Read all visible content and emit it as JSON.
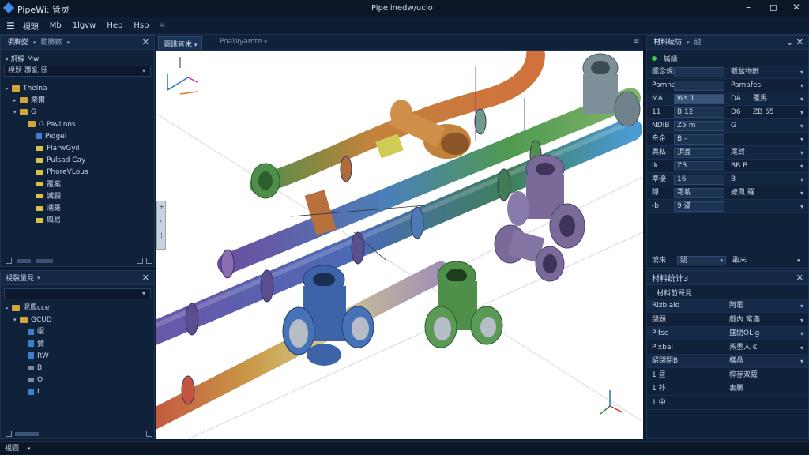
{
  "app": {
    "title": "PipeWi: 管灵",
    "window_title": "Pipelinedw/ucio"
  },
  "menu": [
    "視頭",
    "Mb",
    "1lgvw",
    "Hep",
    "Hsp"
  ],
  "left_top": {
    "tabs": [
      "項脚變",
      "勵勝數"
    ],
    "filter": "飛線 Mw",
    "select_label": "視題 覆亂  岡",
    "tree": [
      {
        "label": "Thelna",
        "icon": "folder",
        "indent": 0,
        "arrow": "▸"
      },
      {
        "label": "樂爾",
        "icon": "folder",
        "indent": 1,
        "arrow": "▸"
      },
      {
        "label": "G",
        "icon": "folder",
        "indent": 1,
        "arrow": "▾"
      },
      {
        "label": "G Pavlinos",
        "icon": "folder",
        "indent": 2,
        "arrow": ""
      },
      {
        "label": "Pidgel",
        "icon": "blue",
        "indent": 3,
        "arrow": ""
      },
      {
        "label": "FlarwGyil",
        "icon": "green",
        "indent": 3,
        "arrow": ""
      },
      {
        "label": "Pulsad Cay",
        "icon": "green",
        "indent": 3,
        "arrow": ""
      },
      {
        "label": "PhoreVLous",
        "icon": "green",
        "indent": 3,
        "arrow": ""
      },
      {
        "label": "覆案",
        "icon": "green",
        "indent": 3,
        "arrow": ""
      },
      {
        "label": "滅闢",
        "icon": "green",
        "indent": 3,
        "arrow": ""
      },
      {
        "label": "潮羅",
        "icon": "green",
        "indent": 3,
        "arrow": ""
      },
      {
        "label": "鳳易",
        "icon": "green",
        "indent": 3,
        "arrow": ""
      }
    ]
  },
  "left_bottom": {
    "tab": "視裂量見",
    "tree": [
      {
        "label": "泥鳳cce",
        "icon": "folder",
        "indent": 0,
        "arrow": "▸"
      },
      {
        "label": "GCUD",
        "icon": "folder",
        "indent": 1,
        "arrow": "▾"
      },
      {
        "label": "帽",
        "icon": "blue",
        "indent": 2,
        "arrow": ""
      },
      {
        "label": "贊",
        "icon": "blue",
        "indent": 2,
        "arrow": ""
      },
      {
        "label": "RW",
        "icon": "blue",
        "indent": 2,
        "arrow": ""
      },
      {
        "label": "B",
        "icon": "gray",
        "indent": 2,
        "arrow": ""
      },
      {
        "label": "O",
        "icon": "gray",
        "indent": 2,
        "arrow": ""
      },
      {
        "label": "I",
        "icon": "blue",
        "indent": 2,
        "arrow": ""
      }
    ]
  },
  "center": {
    "tabs": [
      "圓礁管末",
      "PoaWyamte"
    ]
  },
  "right_top": {
    "tabs": [
      "材料統坊",
      "越"
    ],
    "status_label": "属級",
    "rows": [
      {
        "k": "艦念規劃",
        "a": "",
        "b": "觀盆物數",
        "c": ""
      },
      {
        "k": "Pomnaerea",
        "a": "",
        "b": "Pamafes",
        "c": ""
      },
      {
        "k": "MA",
        "a": "Ws 1",
        "b": "DA",
        "c": "覆馬"
      },
      {
        "k": "11",
        "a": "B 12",
        "b": "D6",
        "c": "ZB 55"
      },
      {
        "k": "NDIB",
        "a": "Z5 m",
        "b": "G",
        "c": ""
      },
      {
        "k": "舟金",
        "a": "B -",
        "b": "",
        "c": ""
      },
      {
        "k": "異私",
        "a": "頂蓋",
        "b": "尾賀",
        "c": ""
      },
      {
        "k": "Ik",
        "a": "ZB",
        "b": "BB B",
        "c": ""
      },
      {
        "k": "準優",
        "a": "16",
        "b": "B",
        "c": ""
      },
      {
        "k": "隠",
        "a": "霜載",
        "b": "嬤鳳 羅",
        "c": ""
      },
      {
        "k": "-b",
        "a": "9 滿",
        "b": "",
        "c": ""
      }
    ],
    "footer": [
      "瀉來",
      "閉",
      "敢末"
    ]
  },
  "right_bottom": {
    "tab": "材料统计3",
    "subtitle": "材料前哥見",
    "rows": [
      {
        "k": "Rizblaio",
        "v": "阿電"
      },
      {
        "k": "閉題",
        "v": "戲内  富滿"
      },
      {
        "k": "Plfse",
        "v": "盛閉OLlg"
      },
      {
        "k": "Plxbal",
        "v": "蒸墨入 €"
      },
      {
        "k": "紹閉閉B",
        "v": "樣晶"
      },
      {
        "k": "1 昼",
        "v": "梓存双薩"
      },
      {
        "k": "1 扑",
        "v": "裏勝"
      },
      {
        "k": "1 中",
        "v": ""
      }
    ]
  },
  "status": {
    "label": "視圓"
  }
}
